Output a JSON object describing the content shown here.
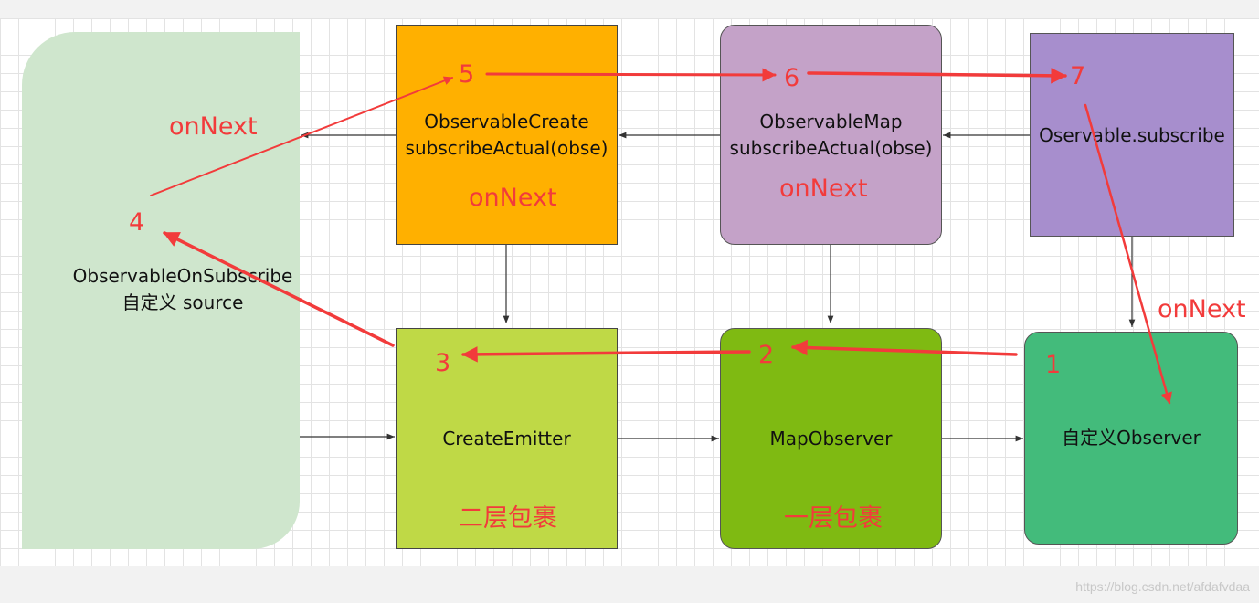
{
  "nodes": {
    "source": "ObservableOnSubscribe\n自定义 source",
    "create": "ObservableCreate\nsubscribeActual(obse)",
    "map": "ObservableMap\nsubscribeActual(obse)",
    "subscribe": "Oservable.subscribe",
    "emitter": "CreateEmitter",
    "mapobs": "MapObserver",
    "observer": "自定义Observer"
  },
  "annotations": {
    "onnext_left": "onNext",
    "onnext_create": "onNext",
    "onnext_map": "onNext",
    "onnext_right": "onNext",
    "layer_two": "二层包裹",
    "layer_one": "一层包裹"
  },
  "steps": [
    "1",
    "2",
    "3",
    "4",
    "5",
    "6",
    "7"
  ],
  "colors": {
    "source": "#cfe6cd",
    "create": "#ffb000",
    "map": "#c4a2c8",
    "subscribe": "#a78ecd",
    "emitter": "#bfd946",
    "mapobs": "#7fba12",
    "observer": "#43bb7b",
    "annotation": "#f23b3b"
  },
  "watermark": "https://blog.csdn.net/afdafvdaa"
}
